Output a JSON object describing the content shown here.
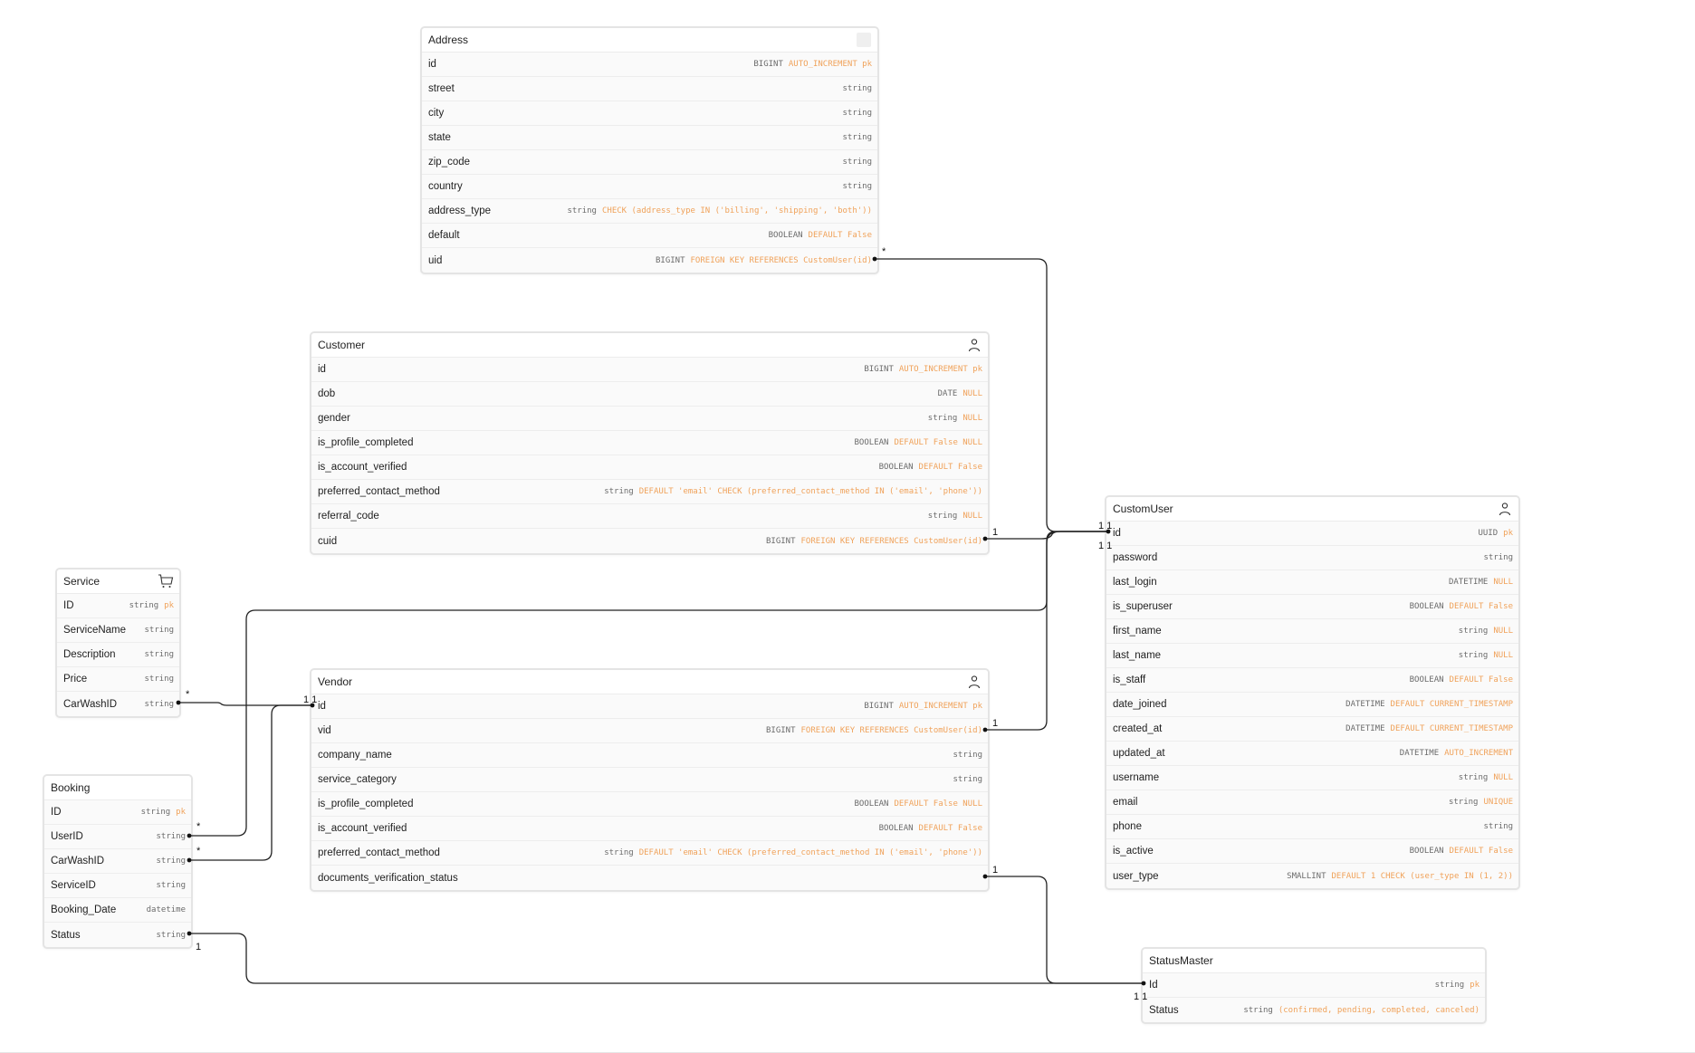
{
  "tables": {
    "address": {
      "name": "Address",
      "icon": "placeholder-icon",
      "fields": [
        {
          "name": "id",
          "type": "BIGINT",
          "constraint": "AUTO_INCREMENT pk"
        },
        {
          "name": "street",
          "type": "string",
          "constraint": ""
        },
        {
          "name": "city",
          "type": "string",
          "constraint": ""
        },
        {
          "name": "state",
          "type": "string",
          "constraint": ""
        },
        {
          "name": "zip_code",
          "type": "string",
          "constraint": ""
        },
        {
          "name": "country",
          "type": "string",
          "constraint": ""
        },
        {
          "name": "address_type",
          "type": "string",
          "constraint": "CHECK (address_type IN ('billing', 'shipping', 'both'))"
        },
        {
          "name": "default",
          "type": "BOOLEAN",
          "constraint": "DEFAULT False"
        },
        {
          "name": "uid",
          "type": "BIGINT",
          "constraint": "FOREIGN KEY REFERENCES CustomUser(id)"
        }
      ]
    },
    "customer": {
      "name": "Customer",
      "icon": "user-icon",
      "fields": [
        {
          "name": "id",
          "type": "BIGINT",
          "constraint": "AUTO_INCREMENT pk"
        },
        {
          "name": "dob",
          "type": "DATE",
          "constraint": "NULL"
        },
        {
          "name": "gender",
          "type": "string",
          "constraint": "NULL"
        },
        {
          "name": "is_profile_completed",
          "type": "BOOLEAN",
          "constraint": "DEFAULT False NULL"
        },
        {
          "name": "is_account_verified",
          "type": "BOOLEAN",
          "constraint": "DEFAULT False"
        },
        {
          "name": "preferred_contact_method",
          "type": "string",
          "constraint": "DEFAULT 'email' CHECK (preferred_contact_method IN ('email', 'phone'))"
        },
        {
          "name": "referral_code",
          "type": "string",
          "constraint": "NULL"
        },
        {
          "name": "cuid",
          "type": "BIGINT",
          "constraint": "FOREIGN KEY REFERENCES CustomUser(id)"
        }
      ]
    },
    "vendor": {
      "name": "Vendor",
      "icon": "user-icon",
      "fields": [
        {
          "name": "id",
          "type": "BIGINT",
          "constraint": "AUTO_INCREMENT pk"
        },
        {
          "name": "vid",
          "type": "BIGINT",
          "constraint": "FOREIGN KEY REFERENCES CustomUser(id)"
        },
        {
          "name": "company_name",
          "type": "string",
          "constraint": ""
        },
        {
          "name": "service_category",
          "type": "string",
          "constraint": ""
        },
        {
          "name": "is_profile_completed",
          "type": "BOOLEAN",
          "constraint": "DEFAULT False NULL"
        },
        {
          "name": "is_account_verified",
          "type": "BOOLEAN",
          "constraint": "DEFAULT False"
        },
        {
          "name": "preferred_contact_method",
          "type": "string",
          "constraint": "DEFAULT 'email' CHECK (preferred_contact_method IN ('email', 'phone'))"
        },
        {
          "name": "documents_verification_status",
          "type": "",
          "constraint": ""
        }
      ]
    },
    "customuser": {
      "name": "CustomUser",
      "icon": "user-icon",
      "fields": [
        {
          "name": "id",
          "type": "UUID",
          "constraint": "pk"
        },
        {
          "name": "password",
          "type": "string",
          "constraint": ""
        },
        {
          "name": "last_login",
          "type": "DATETIME",
          "constraint": "NULL"
        },
        {
          "name": "is_superuser",
          "type": "BOOLEAN",
          "constraint": "DEFAULT False"
        },
        {
          "name": "first_name",
          "type": "string",
          "constraint": "NULL"
        },
        {
          "name": "last_name",
          "type": "string",
          "constraint": "NULL"
        },
        {
          "name": "is_staff",
          "type": "BOOLEAN",
          "constraint": "DEFAULT False"
        },
        {
          "name": "date_joined",
          "type": "DATETIME",
          "constraint": "DEFAULT CURRENT_TIMESTAMP"
        },
        {
          "name": "created_at",
          "type": "DATETIME",
          "constraint": "DEFAULT CURRENT_TIMESTAMP"
        },
        {
          "name": "updated_at",
          "type": "DATETIME",
          "constraint": "AUTO_INCREMENT"
        },
        {
          "name": "username",
          "type": "string",
          "constraint": "NULL"
        },
        {
          "name": "email",
          "type": "string",
          "constraint": "UNIQUE"
        },
        {
          "name": "phone",
          "type": "string",
          "constraint": ""
        },
        {
          "name": "is_active",
          "type": "BOOLEAN",
          "constraint": "DEFAULT False"
        },
        {
          "name": "user_type",
          "type": "SMALLINT",
          "constraint": "DEFAULT 1 CHECK (user_type IN (1, 2))"
        }
      ]
    },
    "service": {
      "name": "Service",
      "icon": "cart-icon",
      "fields": [
        {
          "name": "ID",
          "type": "string",
          "constraint": "pk"
        },
        {
          "name": "ServiceName",
          "type": "string",
          "constraint": ""
        },
        {
          "name": "Description",
          "type": "string",
          "constraint": ""
        },
        {
          "name": "Price",
          "type": "string",
          "constraint": ""
        },
        {
          "name": "CarWashID",
          "type": "string",
          "constraint": ""
        }
      ]
    },
    "booking": {
      "name": "Booking",
      "icon": "",
      "fields": [
        {
          "name": "ID",
          "type": "string",
          "constraint": "pk"
        },
        {
          "name": "UserID",
          "type": "string",
          "constraint": ""
        },
        {
          "name": "CarWashID",
          "type": "string",
          "constraint": ""
        },
        {
          "name": "ServiceID",
          "type": "string",
          "constraint": ""
        },
        {
          "name": "Booking_Date",
          "type": "datetime",
          "constraint": ""
        },
        {
          "name": "Status",
          "type": "string",
          "constraint": ""
        }
      ]
    },
    "statusmaster": {
      "name": "StatusMaster",
      "icon": "",
      "fields": [
        {
          "name": "Id",
          "type": "string",
          "constraint": "pk"
        },
        {
          "name": "Status",
          "type": "string",
          "constraint": "(confirmed, pending, completed, canceled)"
        }
      ]
    }
  },
  "relations": [
    {
      "from": "Address.uid",
      "to": "CustomUser.id",
      "from_card": "*",
      "to_card": "1"
    },
    {
      "from": "Customer.cuid",
      "to": "CustomUser.id",
      "from_card": "1",
      "to_card": "1"
    },
    {
      "from": "Vendor.vid",
      "to": "CustomUser.id",
      "from_card": "1",
      "to_card": "1"
    },
    {
      "from": "Booking.UserID",
      "to": "CustomUser.id",
      "from_card": "*",
      "to_card": "1"
    },
    {
      "from": "Service.CarWashID",
      "to": "Vendor.id",
      "from_card": "*",
      "to_card": "1"
    },
    {
      "from": "Booking.CarWashID",
      "to": "Vendor.id",
      "from_card": "*",
      "to_card": "1"
    },
    {
      "from": "Vendor.documents_verification_status",
      "to": "StatusMaster.Id",
      "from_card": "1",
      "to_card": "1"
    },
    {
      "from": "Booking.Status",
      "to": "StatusMaster.Id",
      "from_card": "1",
      "to_card": "1"
    }
  ],
  "colors": {
    "constraint": "#f0a25a",
    "type": "#6b6b6b",
    "edge": "#222222"
  }
}
